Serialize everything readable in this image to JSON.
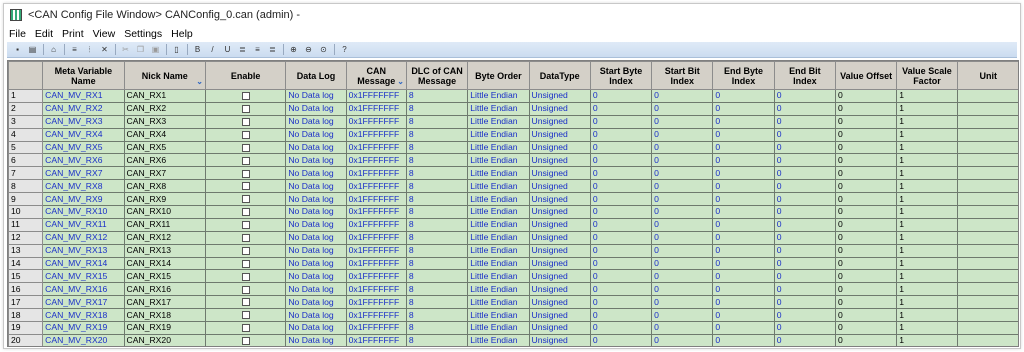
{
  "window": {
    "title": "<CAN Config File Window>  CANConfig_0.can (admin) -"
  },
  "menu": [
    "File",
    "Edit",
    "Print",
    "View",
    "Settings",
    "Help"
  ],
  "toolbar_icons": [
    "save-icon",
    "print-icon",
    "sep",
    "home-icon",
    "sep",
    "insert-row-icon",
    "insert-column-icon",
    "delete-icon",
    "sep",
    "cut-icon",
    "copy-icon",
    "paste-icon",
    "sep",
    "clipboard-icon",
    "sep",
    "bold-icon",
    "italic-icon",
    "underline-icon",
    "align-left-icon",
    "align-center-icon",
    "align-right-icon",
    "sep",
    "zoom-in-icon",
    "zoom-out-icon",
    "zoom-fit-icon",
    "sep",
    "help-icon"
  ],
  "columns": [
    {
      "key": "row",
      "label": ""
    },
    {
      "key": "meta",
      "label": "Meta Variable Name"
    },
    {
      "key": "nick",
      "label": "Nick Name",
      "sort": true
    },
    {
      "key": "enable",
      "label": "Enable"
    },
    {
      "key": "datalog",
      "label": "Data Log"
    },
    {
      "key": "canmsg",
      "label": "CAN Message",
      "sort": true
    },
    {
      "key": "dlc",
      "label": "DLC of CAN Message"
    },
    {
      "key": "byteorder",
      "label": "Byte Order"
    },
    {
      "key": "datatype",
      "label": "DataType"
    },
    {
      "key": "startbyte",
      "label": "Start Byte Index"
    },
    {
      "key": "startbit",
      "label": "Start Bit Index"
    },
    {
      "key": "endbyte",
      "label": "End Byte Index"
    },
    {
      "key": "endbit",
      "label": "End Bit Index"
    },
    {
      "key": "offset",
      "label": "Value Offset"
    },
    {
      "key": "scale",
      "label": "Value Scale Factor"
    },
    {
      "key": "unit",
      "label": "Unit"
    }
  ],
  "rows": [
    {
      "row": "1",
      "meta": "CAN_MV_RX1",
      "nick": "CAN_RX1",
      "enable": false,
      "datalog": "No Data log",
      "canmsg": "0x1FFFFFFF",
      "dlc": "8",
      "byteorder": "Little Endian",
      "datatype": "Unsigned",
      "startbyte": "0",
      "startbit": "0",
      "endbyte": "0",
      "endbit": "0",
      "offset": "0",
      "scale": "1",
      "unit": ""
    },
    {
      "row": "2",
      "meta": "CAN_MV_RX2",
      "nick": "CAN_RX2",
      "enable": false,
      "datalog": "No Data log",
      "canmsg": "0x1FFFFFFF",
      "dlc": "8",
      "byteorder": "Little Endian",
      "datatype": "Unsigned",
      "startbyte": "0",
      "startbit": "0",
      "endbyte": "0",
      "endbit": "0",
      "offset": "0",
      "scale": "1",
      "unit": ""
    },
    {
      "row": "3",
      "meta": "CAN_MV_RX3",
      "nick": "CAN_RX3",
      "enable": false,
      "datalog": "No Data log",
      "canmsg": "0x1FFFFFFF",
      "dlc": "8",
      "byteorder": "Little Endian",
      "datatype": "Unsigned",
      "startbyte": "0",
      "startbit": "0",
      "endbyte": "0",
      "endbit": "0",
      "offset": "0",
      "scale": "1",
      "unit": ""
    },
    {
      "row": "4",
      "meta": "CAN_MV_RX4",
      "nick": "CAN_RX4",
      "enable": false,
      "datalog": "No Data log",
      "canmsg": "0x1FFFFFFF",
      "dlc": "8",
      "byteorder": "Little Endian",
      "datatype": "Unsigned",
      "startbyte": "0",
      "startbit": "0",
      "endbyte": "0",
      "endbit": "0",
      "offset": "0",
      "scale": "1",
      "unit": ""
    },
    {
      "row": "5",
      "meta": "CAN_MV_RX5",
      "nick": "CAN_RX5",
      "enable": false,
      "datalog": "No Data log",
      "canmsg": "0x1FFFFFFF",
      "dlc": "8",
      "byteorder": "Little Endian",
      "datatype": "Unsigned",
      "startbyte": "0",
      "startbit": "0",
      "endbyte": "0",
      "endbit": "0",
      "offset": "0",
      "scale": "1",
      "unit": ""
    },
    {
      "row": "6",
      "meta": "CAN_MV_RX6",
      "nick": "CAN_RX6",
      "enable": false,
      "datalog": "No Data log",
      "canmsg": "0x1FFFFFFF",
      "dlc": "8",
      "byteorder": "Little Endian",
      "datatype": "Unsigned",
      "startbyte": "0",
      "startbit": "0",
      "endbyte": "0",
      "endbit": "0",
      "offset": "0",
      "scale": "1",
      "unit": ""
    },
    {
      "row": "7",
      "meta": "CAN_MV_RX7",
      "nick": "CAN_RX7",
      "enable": false,
      "datalog": "No Data log",
      "canmsg": "0x1FFFFFFF",
      "dlc": "8",
      "byteorder": "Little Endian",
      "datatype": "Unsigned",
      "startbyte": "0",
      "startbit": "0",
      "endbyte": "0",
      "endbit": "0",
      "offset": "0",
      "scale": "1",
      "unit": ""
    },
    {
      "row": "8",
      "meta": "CAN_MV_RX8",
      "nick": "CAN_RX8",
      "enable": false,
      "datalog": "No Data log",
      "canmsg": "0x1FFFFFFF",
      "dlc": "8",
      "byteorder": "Little Endian",
      "datatype": "Unsigned",
      "startbyte": "0",
      "startbit": "0",
      "endbyte": "0",
      "endbit": "0",
      "offset": "0",
      "scale": "1",
      "unit": ""
    },
    {
      "row": "9",
      "meta": "CAN_MV_RX9",
      "nick": "CAN_RX9",
      "enable": false,
      "datalog": "No Data log",
      "canmsg": "0x1FFFFFFF",
      "dlc": "8",
      "byteorder": "Little Endian",
      "datatype": "Unsigned",
      "startbyte": "0",
      "startbit": "0",
      "endbyte": "0",
      "endbit": "0",
      "offset": "0",
      "scale": "1",
      "unit": ""
    },
    {
      "row": "10",
      "meta": "CAN_MV_RX10",
      "nick": "CAN_RX10",
      "enable": false,
      "datalog": "No Data log",
      "canmsg": "0x1FFFFFFF",
      "dlc": "8",
      "byteorder": "Little Endian",
      "datatype": "Unsigned",
      "startbyte": "0",
      "startbit": "0",
      "endbyte": "0",
      "endbit": "0",
      "offset": "0",
      "scale": "1",
      "unit": ""
    },
    {
      "row": "11",
      "meta": "CAN_MV_RX11",
      "nick": "CAN_RX11",
      "enable": false,
      "datalog": "No Data log",
      "canmsg": "0x1FFFFFFF",
      "dlc": "8",
      "byteorder": "Little Endian",
      "datatype": "Unsigned",
      "startbyte": "0",
      "startbit": "0",
      "endbyte": "0",
      "endbit": "0",
      "offset": "0",
      "scale": "1",
      "unit": ""
    },
    {
      "row": "12",
      "meta": "CAN_MV_RX12",
      "nick": "CAN_RX12",
      "enable": false,
      "datalog": "No Data log",
      "canmsg": "0x1FFFFFFF",
      "dlc": "8",
      "byteorder": "Little Endian",
      "datatype": "Unsigned",
      "startbyte": "0",
      "startbit": "0",
      "endbyte": "0",
      "endbit": "0",
      "offset": "0",
      "scale": "1",
      "unit": ""
    },
    {
      "row": "13",
      "meta": "CAN_MV_RX13",
      "nick": "CAN_RX13",
      "enable": false,
      "datalog": "No Data log",
      "canmsg": "0x1FFFFFFF",
      "dlc": "8",
      "byteorder": "Little Endian",
      "datatype": "Unsigned",
      "startbyte": "0",
      "startbit": "0",
      "endbyte": "0",
      "endbit": "0",
      "offset": "0",
      "scale": "1",
      "unit": ""
    },
    {
      "row": "14",
      "meta": "CAN_MV_RX14",
      "nick": "CAN_RX14",
      "enable": false,
      "datalog": "No Data log",
      "canmsg": "0x1FFFFFFF",
      "dlc": "8",
      "byteorder": "Little Endian",
      "datatype": "Unsigned",
      "startbyte": "0",
      "startbit": "0",
      "endbyte": "0",
      "endbit": "0",
      "offset": "0",
      "scale": "1",
      "unit": ""
    },
    {
      "row": "15",
      "meta": "CAN_MV_RX15",
      "nick": "CAN_RX15",
      "enable": false,
      "datalog": "No Data log",
      "canmsg": "0x1FFFFFFF",
      "dlc": "8",
      "byteorder": "Little Endian",
      "datatype": "Unsigned",
      "startbyte": "0",
      "startbit": "0",
      "endbyte": "0",
      "endbit": "0",
      "offset": "0",
      "scale": "1",
      "unit": ""
    },
    {
      "row": "16",
      "meta": "CAN_MV_RX16",
      "nick": "CAN_RX16",
      "enable": false,
      "datalog": "No Data log",
      "canmsg": "0x1FFFFFFF",
      "dlc": "8",
      "byteorder": "Little Endian",
      "datatype": "Unsigned",
      "startbyte": "0",
      "startbit": "0",
      "endbyte": "0",
      "endbit": "0",
      "offset": "0",
      "scale": "1",
      "unit": ""
    },
    {
      "row": "17",
      "meta": "CAN_MV_RX17",
      "nick": "CAN_RX17",
      "enable": false,
      "datalog": "No Data log",
      "canmsg": "0x1FFFFFFF",
      "dlc": "8",
      "byteorder": "Little Endian",
      "datatype": "Unsigned",
      "startbyte": "0",
      "startbit": "0",
      "endbyte": "0",
      "endbit": "0",
      "offset": "0",
      "scale": "1",
      "unit": ""
    },
    {
      "row": "18",
      "meta": "CAN_MV_RX18",
      "nick": "CAN_RX18",
      "enable": false,
      "datalog": "No Data log",
      "canmsg": "0x1FFFFFFF",
      "dlc": "8",
      "byteorder": "Little Endian",
      "datatype": "Unsigned",
      "startbyte": "0",
      "startbit": "0",
      "endbyte": "0",
      "endbit": "0",
      "offset": "0",
      "scale": "1",
      "unit": ""
    },
    {
      "row": "19",
      "meta": "CAN_MV_RX19",
      "nick": "CAN_RX19",
      "enable": false,
      "datalog": "No Data log",
      "canmsg": "0x1FFFFFFF",
      "dlc": "8",
      "byteorder": "Little Endian",
      "datatype": "Unsigned",
      "startbyte": "0",
      "startbit": "0",
      "endbyte": "0",
      "endbit": "0",
      "offset": "0",
      "scale": "1",
      "unit": ""
    },
    {
      "row": "20",
      "meta": "CAN_MV_RX20",
      "nick": "CAN_RX20",
      "enable": false,
      "datalog": "No Data log",
      "canmsg": "0x1FFFFFFF",
      "dlc": "8",
      "byteorder": "Little Endian",
      "datatype": "Unsigned",
      "startbyte": "0",
      "startbit": "0",
      "endbyte": "0",
      "endbit": "0",
      "offset": "0",
      "scale": "1",
      "unit": ""
    }
  ],
  "colors": {
    "cell_bg": "#cde6c8",
    "grid_bg": "#9ec19b",
    "header_bg": "#d4d0c8",
    "link_text": "#1a2fc8",
    "toolbar_bg": "#cbdcf0"
  }
}
